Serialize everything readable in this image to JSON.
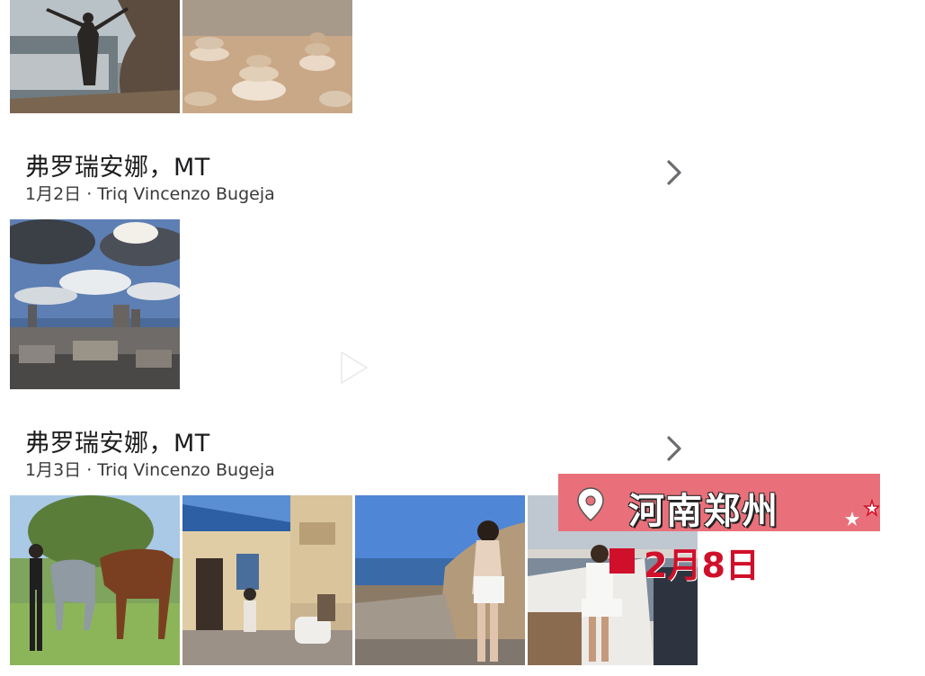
{
  "sections": [
    {
      "title": "弗罗瑞安娜，MT",
      "subtitle": "1月2日 · Triq Vincenzo Bugeja",
      "photos": [
        "skyline-clouds-photo"
      ]
    },
    {
      "title": "弗罗瑞安娜，MT",
      "subtitle": "1月3日 · Triq Vincenzo Bugeja",
      "photos": [
        "horse-field-photo",
        "street-cafe-photo",
        "rocky-beach-photo",
        "yacht-photo"
      ]
    }
  ],
  "top_photos": [
    "cliff-person-photo",
    "stone-stacks-photo"
  ],
  "overlay": {
    "location_text": "河南郑州",
    "date_text": "2月8日",
    "banner_color": "#e9707a",
    "date_color": "#d0102a"
  },
  "icons": {
    "chevron": "chevron-right-icon",
    "play": "play-icon",
    "pin": "map-pin-icon",
    "stars": "star-icon"
  }
}
